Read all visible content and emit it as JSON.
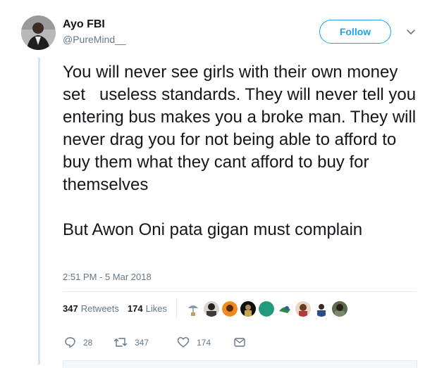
{
  "tweet": {
    "display_name": "Ayo FBI",
    "handle": "@PureMind__",
    "follow_label": "Follow",
    "text": "You will never see girls with their own money set   useless standards. They will never tell you entering bus makes you a broke man. They will never drag you for not being able to afford to buy them what they cant afford to buy for themselves\n\nBut Awon Oni pata gigan must complain",
    "timestamp": "2:51 PM - 5 Mar 2018"
  },
  "stats": {
    "retweets_count": "347",
    "retweets_label": "Retweets",
    "likes_count": "174",
    "likes_label": "Likes"
  },
  "actions": {
    "reply_count": "28",
    "retweet_count": "347",
    "like_count": "174"
  },
  "colors": {
    "accent": "#1da1f2",
    "secondary_text": "#657786",
    "thread_line": "#d7e2ea"
  },
  "icons": [
    "chevron-down-icon",
    "reply-icon",
    "retweet-icon",
    "heart-icon",
    "message-icon"
  ]
}
